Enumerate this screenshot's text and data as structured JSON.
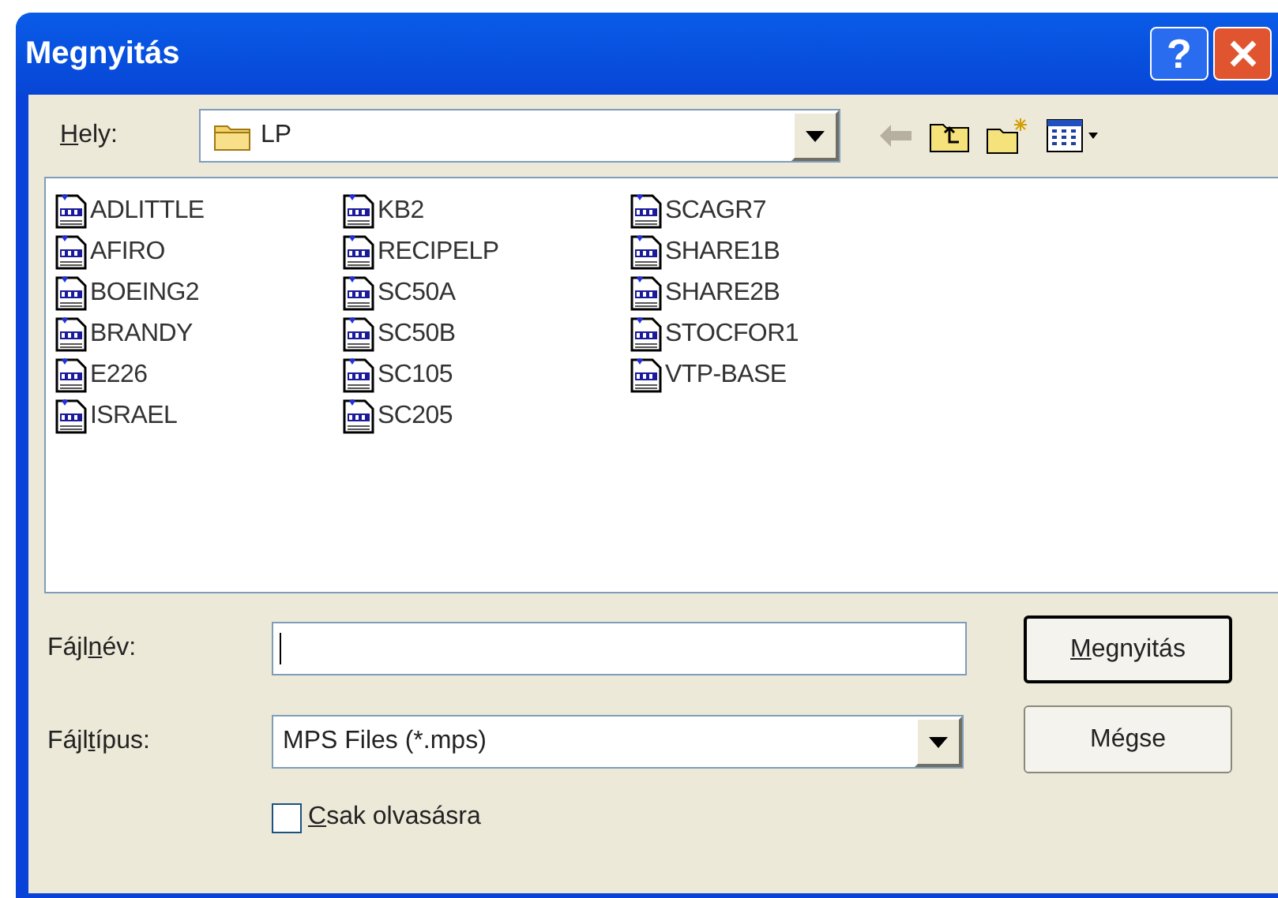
{
  "window": {
    "title": "Megnyitás"
  },
  "title_buttons": [
    {
      "kind": "help",
      "label": "?"
    },
    {
      "kind": "close"
    }
  ],
  "location": {
    "label_parts": {
      "key": "H",
      "post": "ely:"
    },
    "value": "LP"
  },
  "toolbar": [
    {
      "kind": "back",
      "disabled": true
    },
    {
      "kind": "up",
      "disabled": false
    },
    {
      "kind": "new-folder",
      "disabled": false
    },
    {
      "kind": "view",
      "disabled": false
    }
  ],
  "files": [
    {
      "name": "ADLITTLE"
    },
    {
      "name": "AFIRO"
    },
    {
      "name": "BOEING2"
    },
    {
      "name": "BRANDY"
    },
    {
      "name": "E226"
    },
    {
      "name": "ISRAEL"
    },
    {
      "name": "KB2"
    },
    {
      "name": "RECIPELP"
    },
    {
      "name": "SC50A"
    },
    {
      "name": "SC50B"
    },
    {
      "name": "SC105"
    },
    {
      "name": "SC205"
    },
    {
      "name": "SCAGR7"
    },
    {
      "name": "SHARE1B"
    },
    {
      "name": "SHARE2B"
    },
    {
      "name": "STOCFOR1"
    },
    {
      "name": "VTP-BASE"
    }
  ],
  "filename": {
    "label_parts": {
      "pre": "Fájl",
      "key": "n",
      "post": "év:"
    }
  },
  "filetype": {
    "label_parts": {
      "pre": "Fájl",
      "key": "t",
      "post": "ípus:"
    },
    "value": "MPS Files (*.mps)"
  },
  "readonly": {
    "label_parts": {
      "key": "C",
      "post": "sak olvasásra"
    },
    "checked": false
  },
  "buttons": [
    {
      "label_parts": {
        "key": "M",
        "post": "egnyitás"
      },
      "default": true
    },
    {
      "label_parts": {
        "pre": "Mégse"
      },
      "default": false
    }
  ]
}
